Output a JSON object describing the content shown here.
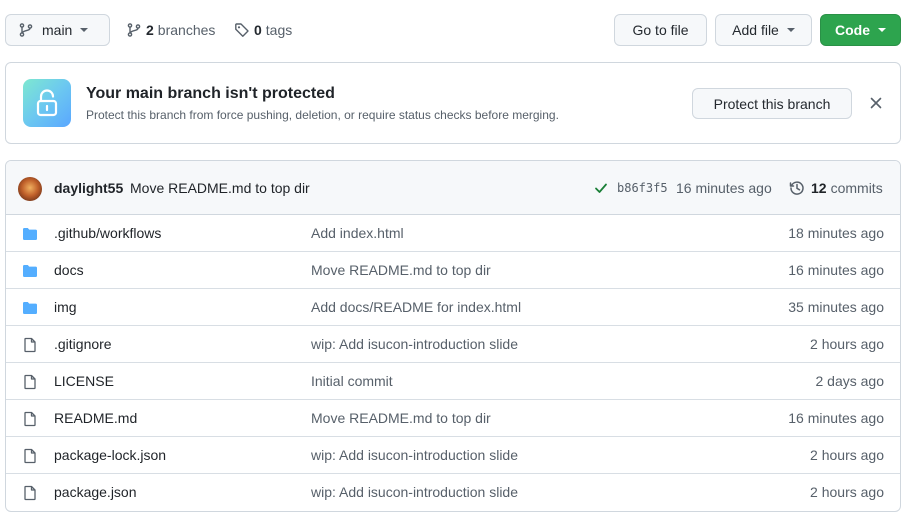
{
  "toolbar": {
    "branch_label": "main",
    "branches_count": "2",
    "branches_label": "branches",
    "tags_count": "0",
    "tags_label": "tags",
    "goto_label": "Go to file",
    "add_label": "Add file",
    "code_label": "Code"
  },
  "banner": {
    "title": "Your main branch isn't protected",
    "description": "Protect this branch from force pushing, deletion, or require status checks before merging.",
    "protect_label": "Protect this branch"
  },
  "commit": {
    "author": "daylight55",
    "message": "Move README.md to top dir",
    "sha": "b86f3f5",
    "time": "16 minutes ago",
    "commits_count": "12",
    "commits_label": "commits"
  },
  "files": [
    {
      "type": "folder",
      "name": ".github/workflows",
      "message": "Add index.html",
      "time": "18 minutes ago"
    },
    {
      "type": "folder",
      "name": "docs",
      "message": "Move README.md to top dir",
      "time": "16 minutes ago"
    },
    {
      "type": "folder",
      "name": "img",
      "message": "Add docs/README for index.html",
      "time": "35 minutes ago"
    },
    {
      "type": "file",
      "name": ".gitignore",
      "message": "wip: Add isucon-introduction slide",
      "time": "2 hours ago"
    },
    {
      "type": "file",
      "name": "LICENSE",
      "message": "Initial commit",
      "time": "2 days ago"
    },
    {
      "type": "file",
      "name": "README.md",
      "message": "Move README.md to top dir",
      "time": "16 minutes ago"
    },
    {
      "type": "file",
      "name": "package-lock.json",
      "message": "wip: Add isucon-introduction slide",
      "time": "2 hours ago"
    },
    {
      "type": "file",
      "name": "package.json",
      "message": "wip: Add isucon-introduction slide",
      "time": "2 hours ago"
    }
  ],
  "colors": {
    "code_button": "#2da44e",
    "folder_icon": "#54aeff",
    "success_check": "#1a7f37"
  }
}
